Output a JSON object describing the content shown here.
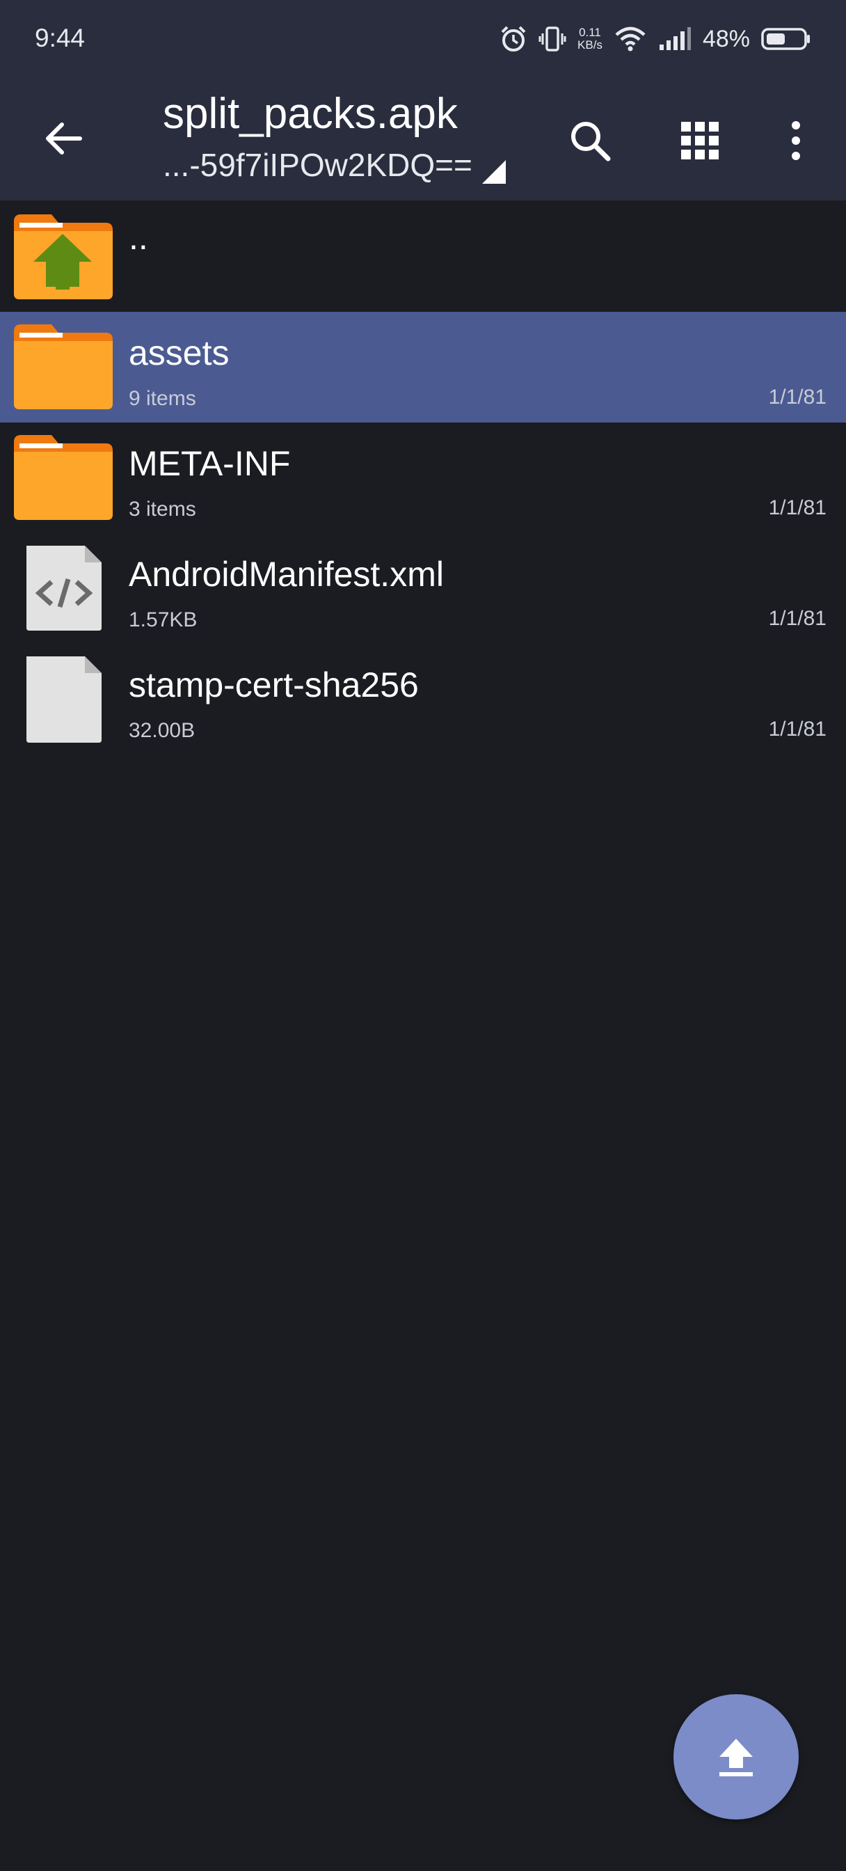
{
  "status_bar": {
    "time": "9:44",
    "net_speed_value": "0.11",
    "net_speed_unit": "KB/s",
    "battery_percent": "48%",
    "icons": [
      "alarm-icon",
      "vibrate-icon",
      "wifi-icon",
      "signal-icon",
      "battery-icon"
    ]
  },
  "app_bar": {
    "title": "split_packs.apk",
    "subtitle": "...-59f7iIPOw2KDQ==",
    "icons": [
      "back-arrow-icon",
      "search-icon",
      "grid-view-icon",
      "more-vert-icon"
    ]
  },
  "files": [
    {
      "name": "..",
      "type": "parent-folder",
      "meta": "",
      "date": ""
    },
    {
      "name": "assets",
      "type": "folder",
      "meta": "9 items",
      "date": "1/1/81",
      "selected": true
    },
    {
      "name": "META-INF",
      "type": "folder",
      "meta": "3 items",
      "date": "1/1/81"
    },
    {
      "name": "AndroidManifest.xml",
      "type": "xml-file",
      "meta": "1.57KB",
      "date": "1/1/81"
    },
    {
      "name": "stamp-cert-sha256",
      "type": "file",
      "meta": "32.00B",
      "date": "1/1/81"
    }
  ],
  "fab": {
    "icon": "upload-icon"
  },
  "colors": {
    "background": "#1b1c21",
    "app_bar": "#2a2d3d",
    "selected_row": "#4b5b92",
    "folder": "#fda62a",
    "folder_tab": "#f07a10",
    "fab": "#7b8cc9"
  }
}
